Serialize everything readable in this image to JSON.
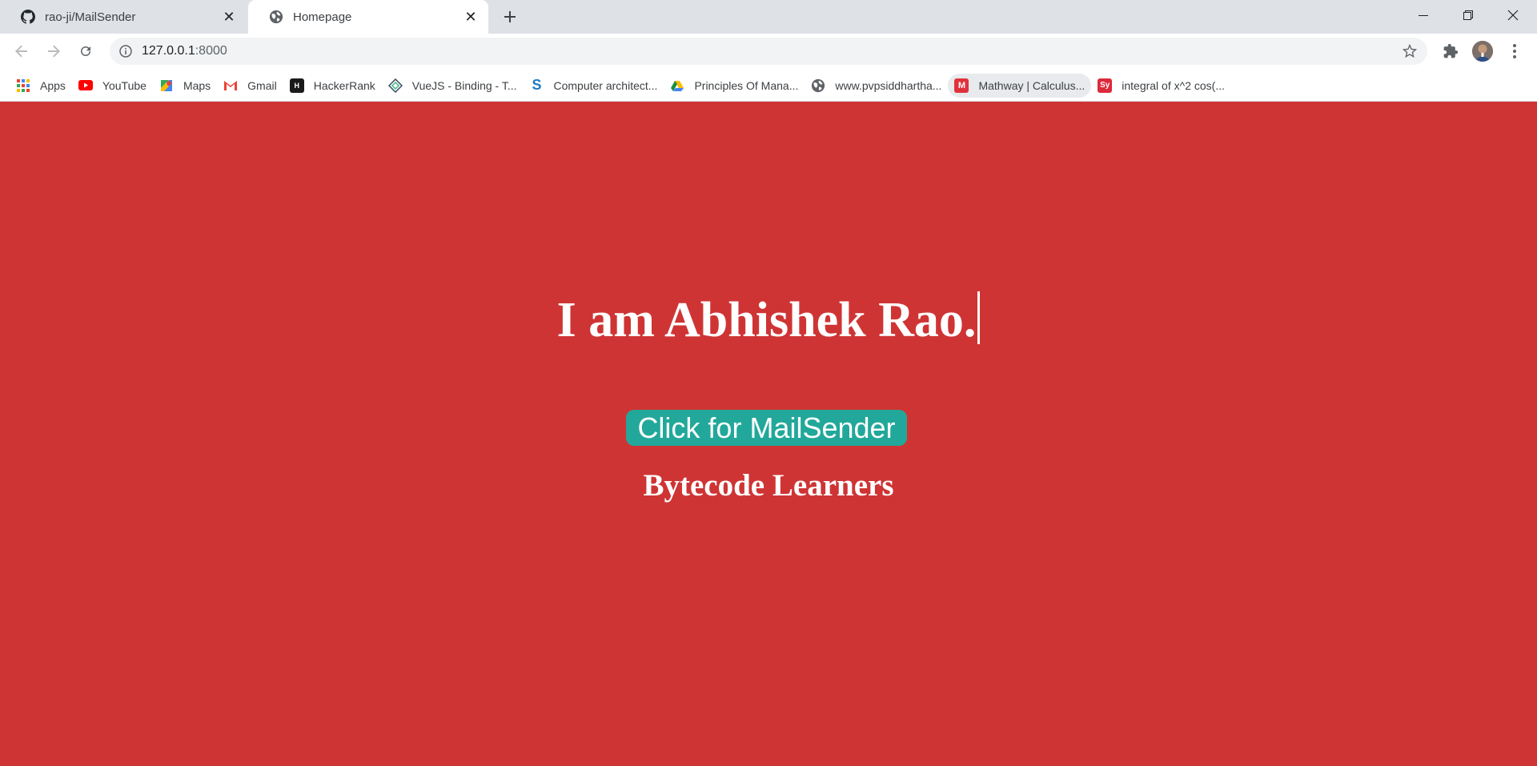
{
  "tabs": [
    {
      "title": "rao-ji/MailSender",
      "icon": "github-icon",
      "active": false
    },
    {
      "title": "Homepage",
      "icon": "globe-icon",
      "active": true
    }
  ],
  "toolbar": {
    "url_host": "127.0.0.1",
    "url_port": ":8000"
  },
  "bookmarks": [
    {
      "label": "Apps",
      "icon": "apps-grid-icon"
    },
    {
      "label": "YouTube",
      "icon": "youtube-icon"
    },
    {
      "label": "Maps",
      "icon": "maps-icon"
    },
    {
      "label": "Gmail",
      "icon": "gmail-icon"
    },
    {
      "label": "HackerRank",
      "icon": "hackerrank-icon"
    },
    {
      "label": "VueJS - Binding - T...",
      "icon": "vuejs-icon"
    },
    {
      "label": "Computer architect...",
      "icon": "scribd-icon"
    },
    {
      "label": "Principles Of Mana...",
      "icon": "drive-icon"
    },
    {
      "label": "www.pvpsiddhartha...",
      "icon": "globe-icon"
    },
    {
      "label": "Mathway | Calculus...",
      "icon": "mathway-icon"
    },
    {
      "label": "integral of x^2 cos(...",
      "icon": "symbolab-icon"
    }
  ],
  "page": {
    "headline": "I am Abhishek Rao.",
    "cta_label": "Click for MailSender",
    "subline": "Bytecode Learners",
    "background_color": "#cf3434",
    "button_color": "#22a89a"
  }
}
